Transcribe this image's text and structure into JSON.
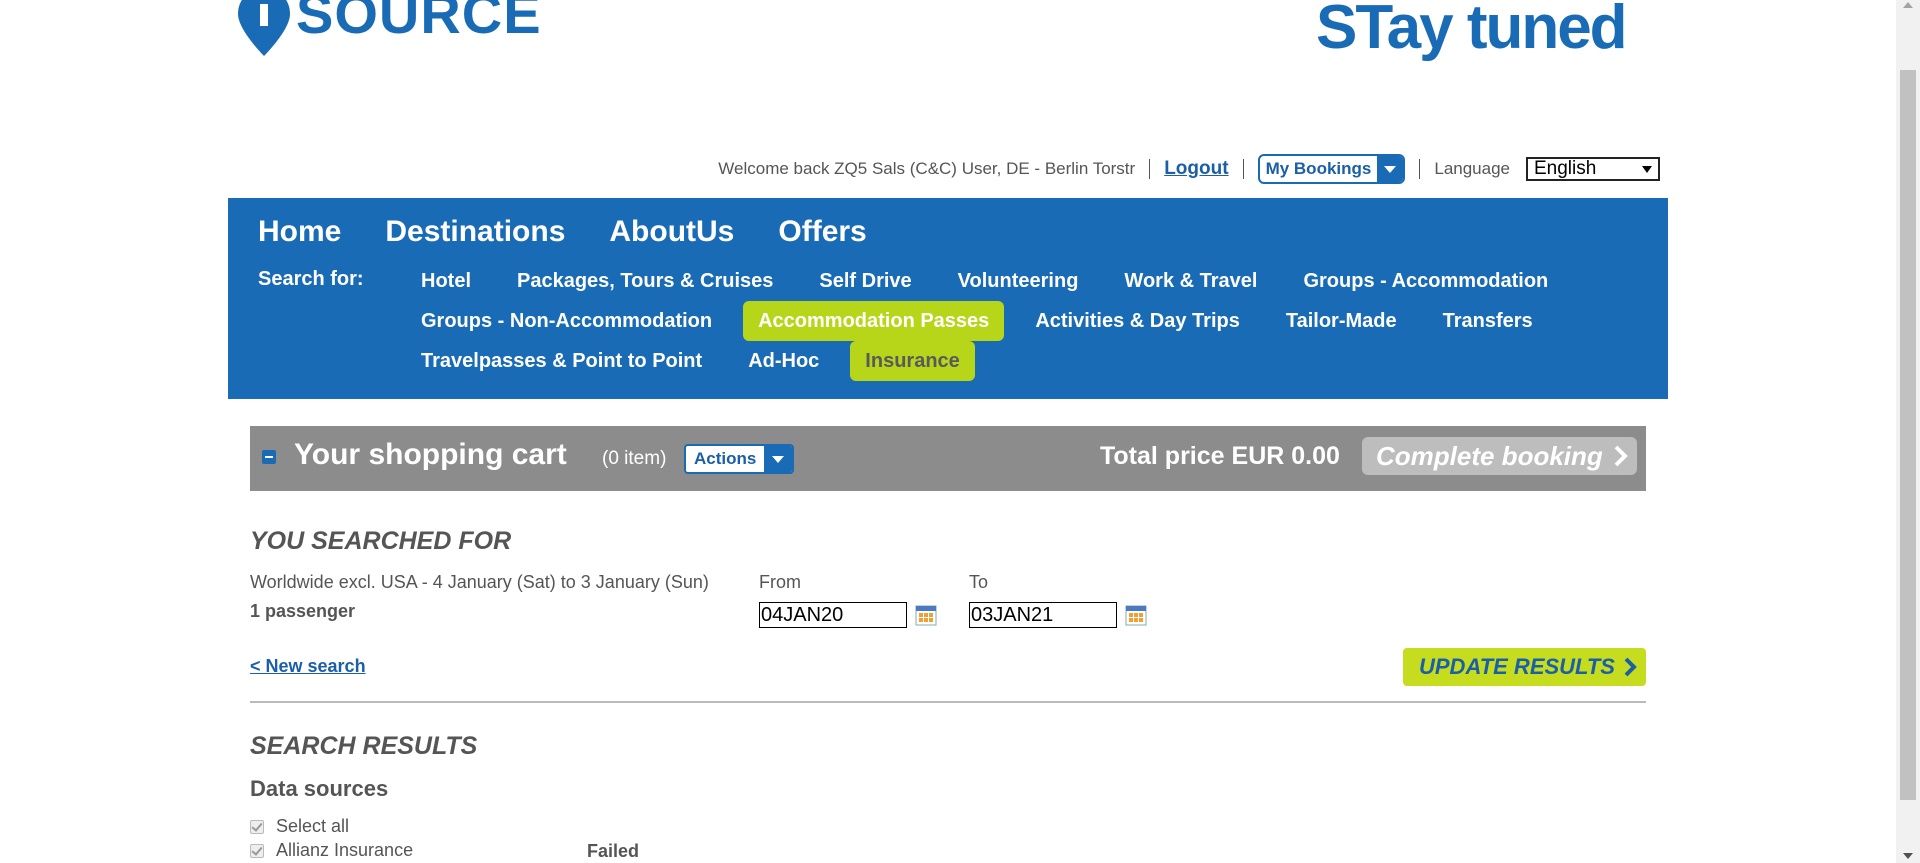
{
  "branding": {
    "logo_left": "SOURCE",
    "logo_right": "STay tuned",
    "brand_color": "#1a6bb5",
    "accent_color": "#b8d619"
  },
  "userbar": {
    "welcome": "Welcome back ZQ5 Sals (C&C) User, DE - Berlin Torstr",
    "logout": "Logout",
    "my_bookings": "My Bookings",
    "language_label": "Language",
    "language_value": "English"
  },
  "nav": {
    "main": [
      "Home",
      "Destinations",
      "AboutUs",
      "Offers"
    ],
    "search_for": "Search for:",
    "row1": [
      "Hotel",
      "Packages, Tours & Cruises",
      "Self Drive",
      "Volunteering",
      "Work & Travel",
      "Groups - Accommodation"
    ],
    "row2": [
      "Groups - Non-Accommodation",
      "Accommodation Passes",
      "Activities & Day Trips",
      "Tailor-Made",
      "Transfers"
    ],
    "row3": [
      "Travelpasses & Point to Point",
      "Ad-Hoc",
      "Insurance"
    ]
  },
  "cart": {
    "title": "Your shopping cart",
    "count": "(0 item)",
    "actions": "Actions",
    "total_label": "Total price",
    "total_value": "EUR 0.00",
    "complete": "Complete booking"
  },
  "search": {
    "heading": "YOU SEARCHED FOR",
    "summary": "Worldwide excl. USA - 4 January (Sat) to 3 January (Sun)",
    "passengers": "1 passenger",
    "from_label": "From",
    "from_value": "04JAN20",
    "to_label": "To",
    "to_value": "03JAN21",
    "new_search": "< New search",
    "update": "UPDATE RESULTS"
  },
  "results": {
    "heading": "SEARCH RESULTS",
    "data_sources": "Data sources",
    "select_all": "Select all",
    "source_name": "Allianz Insurance",
    "source_status": "Failed"
  }
}
